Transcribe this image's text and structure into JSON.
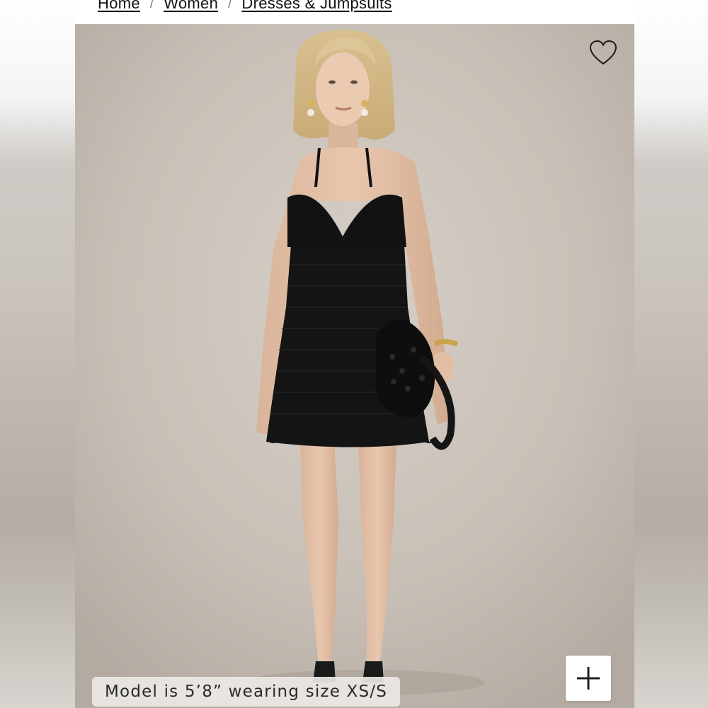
{
  "breadcrumb": {
    "items": [
      {
        "label": "Home"
      },
      {
        "label": "Women"
      },
      {
        "label": "Dresses & Jumpsuits"
      }
    ],
    "separator": "/"
  },
  "product_image": {
    "alt": "Model wearing black crochet halter mini dress holding black crochet bag"
  },
  "favorite": {
    "icon": "heart-outline-icon"
  },
  "zoom": {
    "icon": "plus-icon"
  },
  "caption": {
    "text": "Model is 5’8” wearing size XS/S"
  },
  "colors": {
    "background": "#c9c1b8",
    "dress": "#111111",
    "text": "#111111"
  }
}
